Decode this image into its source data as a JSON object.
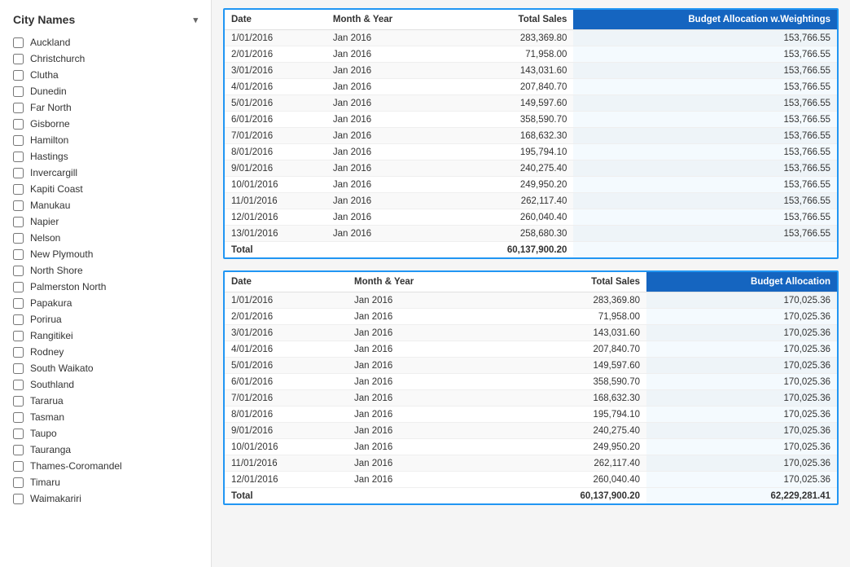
{
  "sidebar": {
    "header": "City Names",
    "chevron": "▾",
    "cities": [
      {
        "name": "Auckland",
        "checked": false
      },
      {
        "name": "Christchurch",
        "checked": false
      },
      {
        "name": "Clutha",
        "checked": false
      },
      {
        "name": "Dunedin",
        "checked": false
      },
      {
        "name": "Far North",
        "checked": false
      },
      {
        "name": "Gisborne",
        "checked": false
      },
      {
        "name": "Hamilton",
        "checked": false
      },
      {
        "name": "Hastings",
        "checked": false
      },
      {
        "name": "Invercargill",
        "checked": false
      },
      {
        "name": "Kapiti Coast",
        "checked": false
      },
      {
        "name": "Manukau",
        "checked": false
      },
      {
        "name": "Napier",
        "checked": false
      },
      {
        "name": "Nelson",
        "checked": false
      },
      {
        "name": "New Plymouth",
        "checked": false
      },
      {
        "name": "North Shore",
        "checked": false
      },
      {
        "name": "Palmerston North",
        "checked": false
      },
      {
        "name": "Papakura",
        "checked": false
      },
      {
        "name": "Porirua",
        "checked": false
      },
      {
        "name": "Rangitikei",
        "checked": false
      },
      {
        "name": "Rodney",
        "checked": false
      },
      {
        "name": "South Waikato",
        "checked": false
      },
      {
        "name": "Southland",
        "checked": false
      },
      {
        "name": "Tararua",
        "checked": false
      },
      {
        "name": "Tasman",
        "checked": false
      },
      {
        "name": "Taupo",
        "checked": false
      },
      {
        "name": "Tauranga",
        "checked": false
      },
      {
        "name": "Thames-Coromandel",
        "checked": false
      },
      {
        "name": "Timaru",
        "checked": false
      },
      {
        "name": "Waimakariri",
        "checked": false
      }
    ]
  },
  "table1": {
    "columns": [
      {
        "key": "date",
        "label": "Date",
        "highlighted": false
      },
      {
        "key": "monthYear",
        "label": "Month & Year",
        "highlighted": false
      },
      {
        "key": "totalSales",
        "label": "Total Sales",
        "highlighted": false,
        "rightAlign": true
      },
      {
        "key": "budgetWeightings",
        "label": "Budget Allocation w.Weightings",
        "highlighted": true,
        "rightAlign": true
      }
    ],
    "rows": [
      {
        "date": "1/01/2016",
        "monthYear": "Jan 2016",
        "totalSales": "283,369.80",
        "budgetWeightings": "153,766.55"
      },
      {
        "date": "2/01/2016",
        "monthYear": "Jan 2016",
        "totalSales": "71,958.00",
        "budgetWeightings": "153,766.55"
      },
      {
        "date": "3/01/2016",
        "monthYear": "Jan 2016",
        "totalSales": "143,031.60",
        "budgetWeightings": "153,766.55"
      },
      {
        "date": "4/01/2016",
        "monthYear": "Jan 2016",
        "totalSales": "207,840.70",
        "budgetWeightings": "153,766.55"
      },
      {
        "date": "5/01/2016",
        "monthYear": "Jan 2016",
        "totalSales": "149,597.60",
        "budgetWeightings": "153,766.55"
      },
      {
        "date": "6/01/2016",
        "monthYear": "Jan 2016",
        "totalSales": "358,590.70",
        "budgetWeightings": "153,766.55"
      },
      {
        "date": "7/01/2016",
        "monthYear": "Jan 2016",
        "totalSales": "168,632.30",
        "budgetWeightings": "153,766.55"
      },
      {
        "date": "8/01/2016",
        "monthYear": "Jan 2016",
        "totalSales": "195,794.10",
        "budgetWeightings": "153,766.55"
      },
      {
        "date": "9/01/2016",
        "monthYear": "Jan 2016",
        "totalSales": "240,275.40",
        "budgetWeightings": "153,766.55"
      },
      {
        "date": "10/01/2016",
        "monthYear": "Jan 2016",
        "totalSales": "249,950.20",
        "budgetWeightings": "153,766.55"
      },
      {
        "date": "11/01/2016",
        "monthYear": "Jan 2016",
        "totalSales": "262,117.40",
        "budgetWeightings": "153,766.55"
      },
      {
        "date": "12/01/2016",
        "monthYear": "Jan 2016",
        "totalSales": "260,040.40",
        "budgetWeightings": "153,766.55"
      },
      {
        "date": "13/01/2016",
        "monthYear": "Jan 2016",
        "totalSales": "258,680.30",
        "budgetWeightings": "153,766.55"
      }
    ],
    "total": {
      "label": "Total",
      "totalSales": "60,137,900.20",
      "budgetWeightings": ""
    }
  },
  "table2": {
    "columns": [
      {
        "key": "date",
        "label": "Date",
        "highlighted": false
      },
      {
        "key": "monthYear",
        "label": "Month & Year",
        "highlighted": false
      },
      {
        "key": "totalSales",
        "label": "Total Sales",
        "highlighted": false,
        "rightAlign": true
      },
      {
        "key": "budget",
        "label": "Budget Allocation",
        "highlighted": true,
        "rightAlign": true
      }
    ],
    "rows": [
      {
        "date": "1/01/2016",
        "monthYear": "Jan 2016",
        "totalSales": "283,369.80",
        "budget": "170,025.36"
      },
      {
        "date": "2/01/2016",
        "monthYear": "Jan 2016",
        "totalSales": "71,958.00",
        "budget": "170,025.36"
      },
      {
        "date": "3/01/2016",
        "monthYear": "Jan 2016",
        "totalSales": "143,031.60",
        "budget": "170,025.36"
      },
      {
        "date": "4/01/2016",
        "monthYear": "Jan 2016",
        "totalSales": "207,840.70",
        "budget": "170,025.36"
      },
      {
        "date": "5/01/2016",
        "monthYear": "Jan 2016",
        "totalSales": "149,597.60",
        "budget": "170,025.36"
      },
      {
        "date": "6/01/2016",
        "monthYear": "Jan 2016",
        "totalSales": "358,590.70",
        "budget": "170,025.36"
      },
      {
        "date": "7/01/2016",
        "monthYear": "Jan 2016",
        "totalSales": "168,632.30",
        "budget": "170,025.36"
      },
      {
        "date": "8/01/2016",
        "monthYear": "Jan 2016",
        "totalSales": "195,794.10",
        "budget": "170,025.36"
      },
      {
        "date": "9/01/2016",
        "monthYear": "Jan 2016",
        "totalSales": "240,275.40",
        "budget": "170,025.36"
      },
      {
        "date": "10/01/2016",
        "monthYear": "Jan 2016",
        "totalSales": "249,950.20",
        "budget": "170,025.36"
      },
      {
        "date": "11/01/2016",
        "monthYear": "Jan 2016",
        "totalSales": "262,117.40",
        "budget": "170,025.36"
      },
      {
        "date": "12/01/2016",
        "monthYear": "Jan 2016",
        "totalSales": "260,040.40",
        "budget": "170,025.36"
      }
    ],
    "total": {
      "label": "Total",
      "totalSales": "60,137,900.20",
      "budget": "62,229,281.41"
    }
  }
}
